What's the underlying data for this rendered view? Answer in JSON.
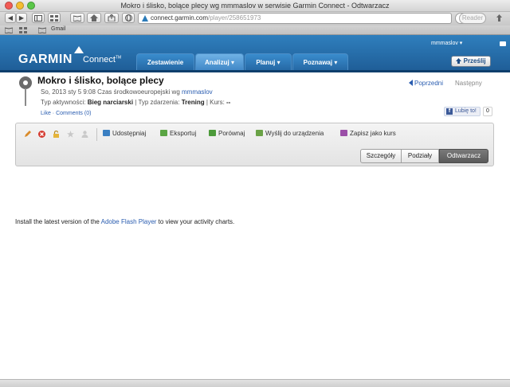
{
  "window": {
    "title": "Mokro i ślisko, bolące plecy wg mmmaslov w serwisie Garmin Connect - Odtwarzacz"
  },
  "browser": {
    "url_host": "connect.garmin.com",
    "url_path": "/player/258651973",
    "reader_label": "Reader",
    "bookmarks": [
      {
        "label": "Gmail"
      }
    ],
    "back_glyph": "◀",
    "forward_glyph": "▶"
  },
  "header": {
    "logo_text": "GARMIN",
    "logo_sub": "Connect",
    "logo_tm": "TM",
    "username": "mmmaslov",
    "user_caret": "▾",
    "nav_tabs": [
      {
        "label": "Zestawienie",
        "active": false,
        "has_caret": false
      },
      {
        "label": "Analizuj",
        "active": true,
        "has_caret": true
      },
      {
        "label": "Planuj",
        "active": false,
        "has_caret": true
      },
      {
        "label": "Poznawaj",
        "active": false,
        "has_caret": true
      }
    ],
    "caret_glyph": "▾",
    "upload_label": "Prześlij",
    "upload_icon": "up-arrow-icon"
  },
  "activity": {
    "title": "Mokro i ślisko, bolące plecy",
    "date_prefix": "So, 2013 sty 5 9:08 Czas środkowoeuropejski wg ",
    "author": "mmmaslov",
    "type_label": "Typ aktywności: ",
    "type_value": "Bieg narciarski",
    "sep1": " | Typ zdarzenia: ",
    "event_value": "Trening",
    "sep2": " | Kurs: ",
    "course_value": "--",
    "like_link": "Like",
    "like_sep": " · ",
    "comments_link": "Comments (0)"
  },
  "pager": {
    "prev_label": "Poprzedni",
    "next_label": "Następny"
  },
  "facebook": {
    "like_label": "Lubię to!",
    "f_letter": "f",
    "count": "0"
  },
  "actions": {
    "icons": [
      {
        "name": "edit-pencil-icon",
        "color": "#d98b2b"
      },
      {
        "name": "delete-icon",
        "color": "#d43a2f"
      },
      {
        "name": "lock-icon",
        "color": "#e5b43a"
      },
      {
        "name": "star-icon",
        "color": "#bdbdbd"
      },
      {
        "name": "person-icon",
        "color": "#c9c9c9"
      }
    ],
    "buttons": [
      {
        "label": "Udostępniaj",
        "icon": "share-icon",
        "color": "#3a7fc2"
      },
      {
        "label": "Eksportuj",
        "icon": "export-icon",
        "color": "#5aa544"
      },
      {
        "label": "Porównaj",
        "icon": "compare-icon",
        "color": "#4c9a3a"
      },
      {
        "label": "Wyślij do urządzenia",
        "icon": "send-device-icon",
        "color": "#6aa246"
      },
      {
        "label": "Zapisz jako kurs",
        "icon": "save-course-icon",
        "color": "#9b4fa8"
      }
    ],
    "view_tabs": [
      {
        "label": "Szczegóły",
        "active": false
      },
      {
        "label": "Podziały",
        "active": false
      },
      {
        "label": "Odtwarzacz",
        "active": true
      }
    ]
  },
  "flash": {
    "prefix": "Install the latest version of the ",
    "link": "Adobe Flash Player",
    "suffix": " to view your activity charts."
  }
}
